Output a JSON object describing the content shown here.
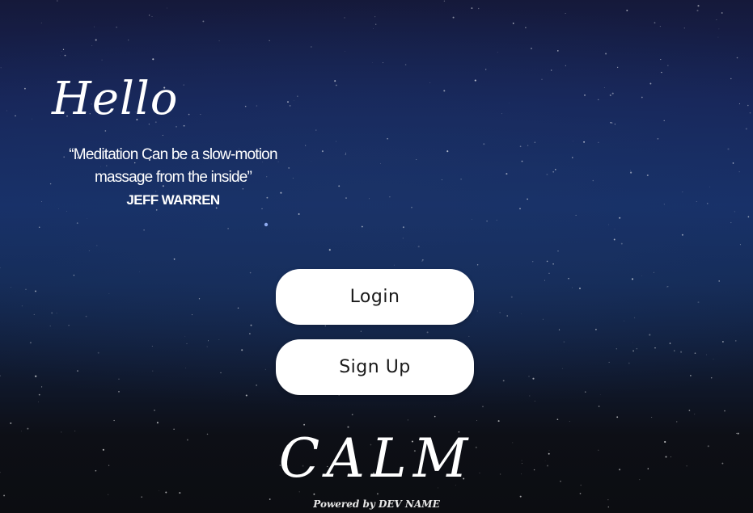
{
  "greeting": "Hello",
  "quote": {
    "line1": "“Meditation Can be a slow-motion",
    "line2": "massage from the inside”",
    "author": "JEFF WARREN"
  },
  "buttons": {
    "login_label": "Login",
    "signup_label": "Sign Up"
  },
  "brand": {
    "name": "CALM",
    "powered_by": "Powered by DEV NAME"
  },
  "colors": {
    "button_bg": "#ffffff",
    "button_text": "#1a1a1a",
    "text": "#ffffff",
    "sky_top": "#172559",
    "sky_bottom": "#0c0d11"
  }
}
